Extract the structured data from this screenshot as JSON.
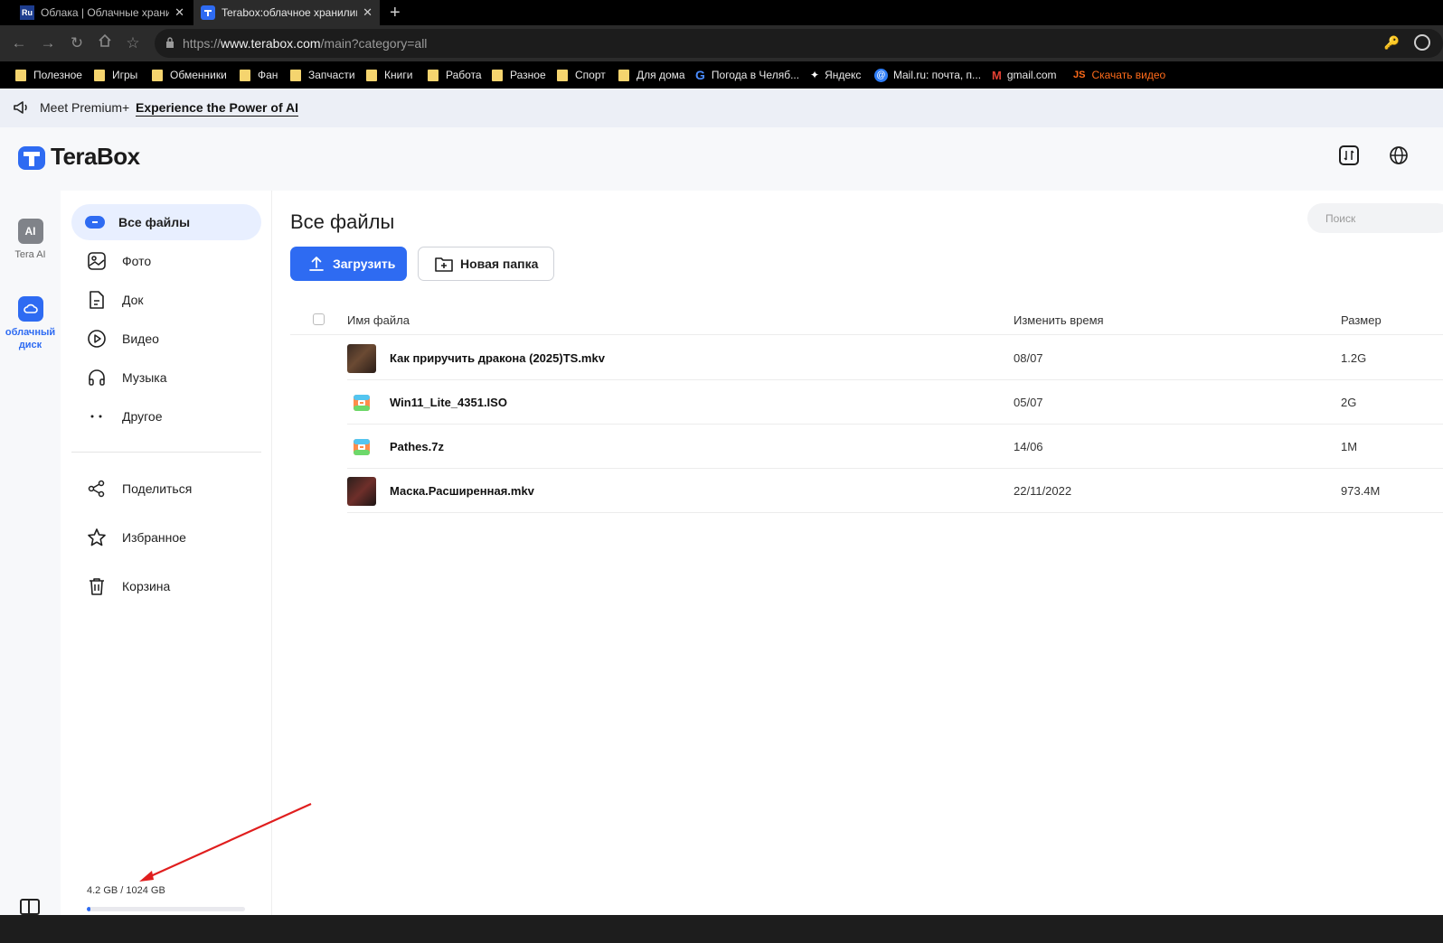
{
  "browser": {
    "tabs": [
      {
        "favicon": "Ru",
        "title": "Облака | Облачные хранилища"
      },
      {
        "favicon": "terabox-favicon",
        "title": "Terabox:облачное хранилище"
      }
    ],
    "url_prefix": "https://",
    "url_host": "www.terabox.com",
    "url_path": "/main?category=all",
    "bookmarks": [
      {
        "icon": "folder",
        "label": "Полезное"
      },
      {
        "icon": "folder",
        "label": "Игры"
      },
      {
        "icon": "folder",
        "label": "Обменники"
      },
      {
        "icon": "folder",
        "label": "Фан"
      },
      {
        "icon": "folder",
        "label": "Запчасти"
      },
      {
        "icon": "folder",
        "label": "Книги"
      },
      {
        "icon": "folder",
        "label": "Работа"
      },
      {
        "icon": "folder",
        "label": "Разное"
      },
      {
        "icon": "folder",
        "label": "Спорт"
      },
      {
        "icon": "folder",
        "label": "Для дома"
      },
      {
        "icon": "google",
        "label": "Погода в Челяб..."
      },
      {
        "icon": "yandex-star",
        "label": "Яндекс"
      },
      {
        "icon": "mailru",
        "label": "Mail.ru: почта, п..."
      },
      {
        "icon": "gmail",
        "label": "gmail.com"
      },
      {
        "icon": "js",
        "label": "Скачать видео"
      }
    ]
  },
  "promo": {
    "meet": "Meet Premium+",
    "link": "Experience the Power of AI"
  },
  "app": {
    "logo_name": "TeraBox",
    "brand_color": "#2e6bf2"
  },
  "rail": {
    "ai_badge": "AI",
    "ai_label": "Tera AI",
    "disk_label": "облачный диск"
  },
  "sidebar": {
    "items": [
      {
        "label": "Все файлы",
        "icon": "all-files-icon",
        "active": true
      },
      {
        "label": "Фото",
        "icon": "photo-icon"
      },
      {
        "label": "Док",
        "icon": "doc-icon"
      },
      {
        "label": "Видео",
        "icon": "video-icon"
      },
      {
        "label": "Музыка",
        "icon": "music-icon"
      },
      {
        "label": "Другое",
        "icon": "other-icon"
      }
    ],
    "secondary": [
      {
        "label": "Поделиться",
        "icon": "share-icon"
      },
      {
        "label": "Избранное",
        "icon": "star-icon"
      },
      {
        "label": "Корзина",
        "icon": "trash-icon"
      }
    ],
    "storage": {
      "text": "4.2 GB / 1024 GB",
      "used_fraction": 0.004
    }
  },
  "main": {
    "title": "Все файлы",
    "search_placeholder": "Поиск",
    "upload_label": "Загрузить",
    "new_folder_label": "Новая папка",
    "columns": {
      "name": "Имя файла",
      "time": "Изменить время",
      "size": "Размер"
    },
    "files": [
      {
        "name": "Как приручить дракона (2025)TS.mkv",
        "time": "08/07",
        "size": "1.2G",
        "type": "video"
      },
      {
        "name": "Win11_Lite_4351.ISO",
        "time": "05/07",
        "size": "2G",
        "type": "archive"
      },
      {
        "name": "Pathes.7z",
        "time": "14/06",
        "size": "1M",
        "type": "archive"
      },
      {
        "name": "Маска.Расширенная.mkv",
        "time": "22/11/2022",
        "size": "973.4M",
        "type": "video"
      }
    ]
  }
}
